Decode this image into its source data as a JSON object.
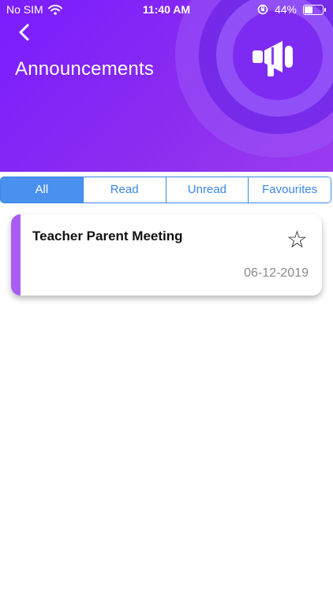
{
  "status_bar": {
    "carrier": "No SIM",
    "time": "11:40 AM",
    "battery_percent": "44%",
    "battery_level": 0.44
  },
  "header": {
    "title": "Announcements",
    "back_icon": "chevron-left-icon",
    "hero_icon": "megaphone-icon",
    "gradient_colors": [
      "#7a1cff",
      "#9b3bf0"
    ]
  },
  "tabs": [
    {
      "label": "All",
      "active": true
    },
    {
      "label": "Read",
      "active": false
    },
    {
      "label": "Unread",
      "active": false
    },
    {
      "label": "Favourites",
      "active": false
    }
  ],
  "announcements": [
    {
      "title": "Teacher Parent Meeting",
      "date": "06-12-2019",
      "favourite_icon": "star-outline-icon",
      "accent_color": "#a95cf2"
    }
  ],
  "colors": {
    "tab_accent": "#3b87e8",
    "tab_active_bg": "#4a90ee"
  }
}
